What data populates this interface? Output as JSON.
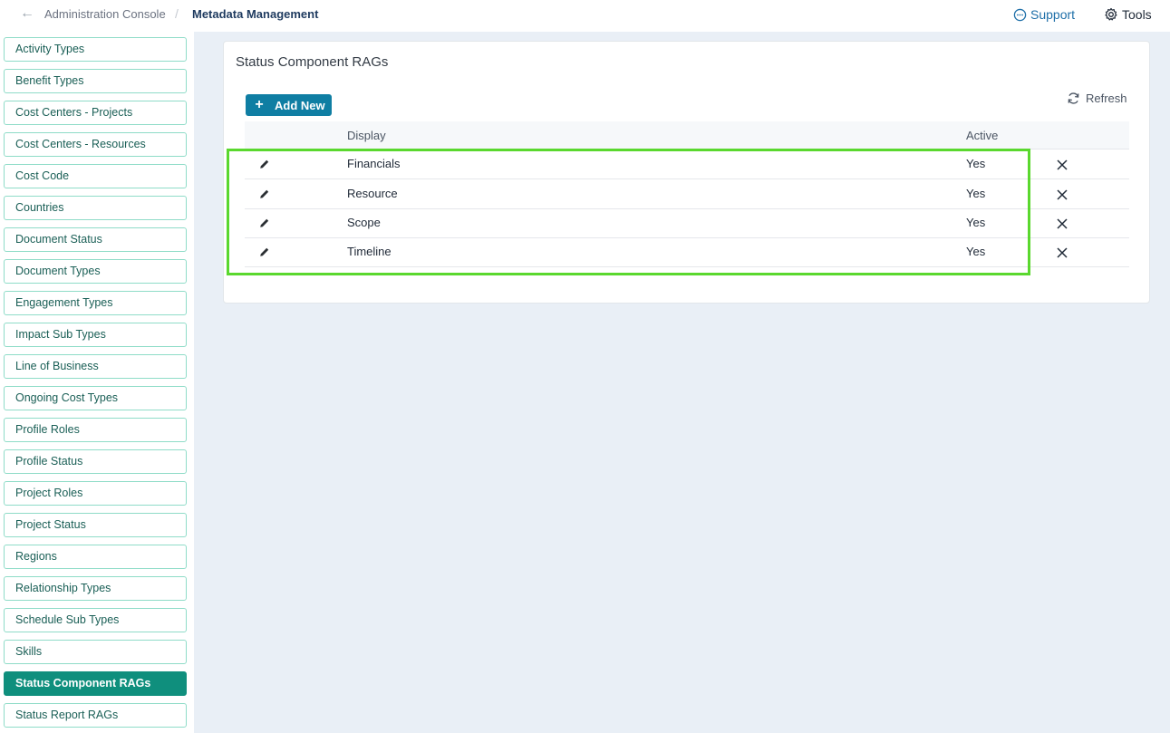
{
  "header": {
    "breadcrumb_parent": "Administration Console",
    "breadcrumb_separator": "/",
    "breadcrumb_current": "Metadata Management",
    "support_label": "Support",
    "tools_label": "Tools"
  },
  "sidebar": {
    "items": [
      {
        "label": "Activity Types"
      },
      {
        "label": "Benefit Types"
      },
      {
        "label": "Cost Centers - Projects"
      },
      {
        "label": "Cost Centers - Resources"
      },
      {
        "label": "Cost Code"
      },
      {
        "label": "Countries"
      },
      {
        "label": "Document Status"
      },
      {
        "label": "Document Types"
      },
      {
        "label": "Engagement Types"
      },
      {
        "label": "Impact Sub Types"
      },
      {
        "label": "Line of Business"
      },
      {
        "label": "Ongoing Cost Types"
      },
      {
        "label": "Profile Roles"
      },
      {
        "label": "Profile Status"
      },
      {
        "label": "Project Roles"
      },
      {
        "label": "Project Status"
      },
      {
        "label": "Regions"
      },
      {
        "label": "Relationship Types"
      },
      {
        "label": "Schedule Sub Types"
      },
      {
        "label": "Skills"
      },
      {
        "label": "Status Component RAGs",
        "active": true
      },
      {
        "label": "Status Report RAGs"
      }
    ]
  },
  "main": {
    "title": "Status Component RAGs",
    "add_label": "Add New",
    "refresh_label": "Refresh",
    "columns": {
      "display": "Display",
      "active": "Active"
    },
    "rows": [
      {
        "display": "Financials",
        "active": "Yes"
      },
      {
        "display": "Resource",
        "active": "Yes"
      },
      {
        "display": "Scope",
        "active": "Yes"
      },
      {
        "display": "Timeline",
        "active": "Yes"
      }
    ]
  },
  "colors": {
    "accent_teal": "#0f8f7d",
    "button_blue": "#0f7ea3",
    "highlight_green": "#5ad82e",
    "support_blue": "#1e6fa8"
  }
}
